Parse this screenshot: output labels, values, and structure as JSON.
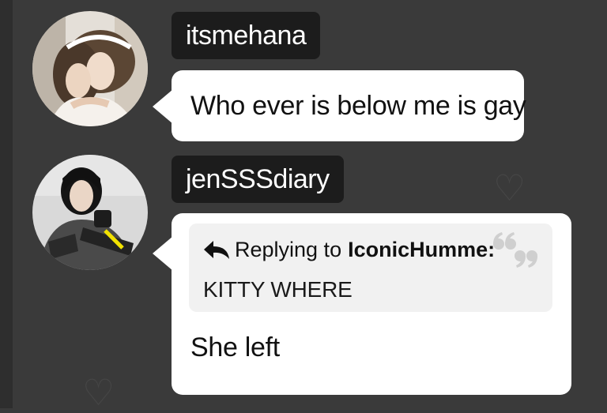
{
  "messages": [
    {
      "username": "itsmehana",
      "text": "Who ever is below me is gay"
    },
    {
      "username": "jenSSSdiary",
      "reply": {
        "prefix": "Replying to",
        "author": "IconicHumme:",
        "quote": "KITTY WHERE"
      },
      "text": "She left"
    }
  ],
  "icons": {
    "reply": "reply-arrow-icon",
    "quote": "quote-marks-icon"
  },
  "colors": {
    "background": "#3a3a3a",
    "username_tag": "#1c1c1c",
    "bubble": "#ffffff",
    "reply_box": "#f1f1f1",
    "quote_icon": "#cfcfcf"
  }
}
